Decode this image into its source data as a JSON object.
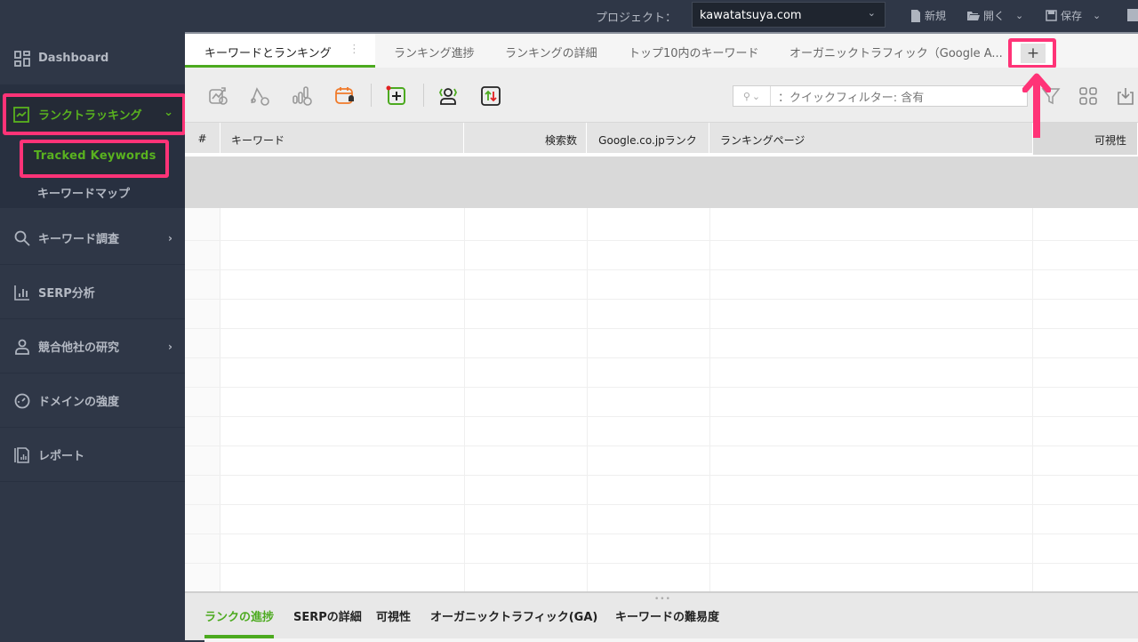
{
  "topbar": {
    "project_label": "プロジェクト：",
    "project_value": "kawatatsuya.com",
    "new_label": "新規",
    "open_label": "開く",
    "save_label": "保存"
  },
  "sidebar": {
    "items": [
      {
        "label": "Dashboard",
        "icon": "dashboard-icon"
      },
      {
        "label": "ランクトラッキング",
        "icon": "chart-line-icon",
        "active": true
      },
      {
        "label": "キーワード調査",
        "icon": "search-icon"
      },
      {
        "label": "SERP分析",
        "icon": "bar-chart-icon"
      },
      {
        "label": "競合他社の研究",
        "icon": "user-icon"
      },
      {
        "label": "ドメインの強度",
        "icon": "gauge-icon"
      },
      {
        "label": "レポート",
        "icon": "report-icon"
      }
    ],
    "subitems": [
      {
        "label": "Tracked Keywords",
        "active": true
      },
      {
        "label": "キーワードマップ"
      }
    ]
  },
  "tabs": [
    {
      "label": "キーワードとランキング",
      "active": true
    },
    {
      "label": "ランキング進捗"
    },
    {
      "label": "ランキングの詳細"
    },
    {
      "label": "トップ10内のキーワード"
    },
    {
      "label": "オーガニックトラフィック（Google A..."
    }
  ],
  "tab_add_label": "+",
  "filter": {
    "placeholder": "：クイックフィルター: 含有"
  },
  "table": {
    "headers": [
      "#",
      "キーワード",
      "検索数",
      "Google.co.jpランク",
      "ランキングページ",
      "可視性"
    ]
  },
  "bottom_tabs": [
    {
      "label": "ランクの進捗",
      "active": true
    },
    {
      "label": "SERPの詳細"
    },
    {
      "label": "可視性"
    },
    {
      "label": "オーガニックトラフィック(GA)"
    },
    {
      "label": "キーワードの難易度"
    }
  ],
  "colors": {
    "accent": "#4caa1f",
    "highlight": "#ff3377",
    "sidebar": "#2f3747"
  }
}
